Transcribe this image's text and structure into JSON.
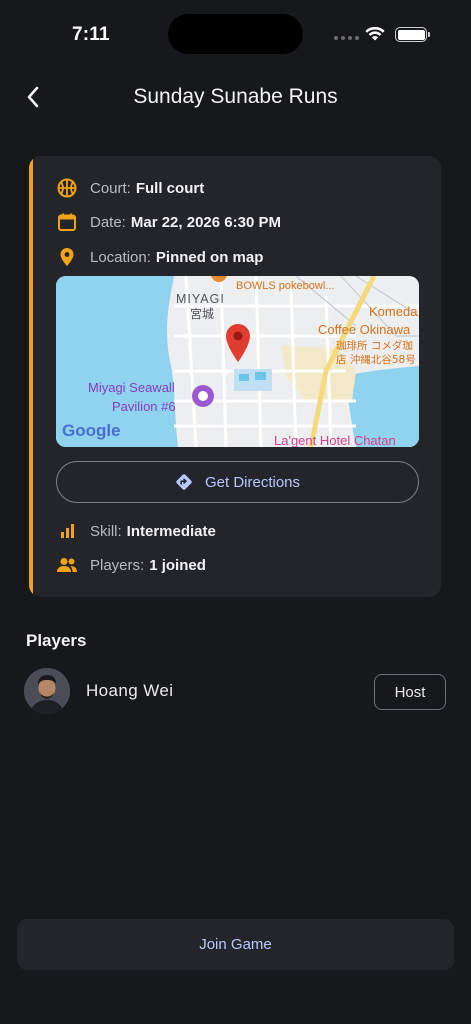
{
  "status_bar": {
    "time": "7:11"
  },
  "header": {
    "title": "Sunday Sunabe Runs"
  },
  "game": {
    "court_label": "Court:",
    "court_value": "Full court",
    "date_label": "Date:",
    "date_value": "Mar 22, 2026 6:30 PM",
    "location_label": "Location:",
    "location_value": "Pinned on map",
    "skill_label": "Skill:",
    "skill_value": "Intermediate",
    "players_label": "Players:",
    "players_value": "1 joined",
    "accent_color": "#f1a21a"
  },
  "map": {
    "labels": {
      "area_en": "MIYAGI",
      "area_jp": "宮城",
      "bowls": "BOWLS pokebowl...",
      "komeda_1": "Komeda",
      "komeda_2": "Coffee Okinawa",
      "komeda_3": "珈琲所 コメダ珈",
      "komeda_4": "店 沖縄北谷58号",
      "seawall_1": "Miyagi Seawall",
      "seawall_2": "Pavilion #6",
      "hotel": "La'gent Hotel Chatan",
      "google": "Google"
    }
  },
  "directions_button": "Get Directions",
  "players_section": {
    "title": "Players",
    "players": [
      {
        "name": "Hoang Wei",
        "badge": "Host"
      }
    ]
  },
  "join_button": "Join Game",
  "icons": {
    "back": "chevron-left-icon",
    "court": "basketball-icon",
    "date": "calendar-icon",
    "location": "location-pin-icon",
    "directions": "directions-icon",
    "skill": "signal-bars-icon",
    "players": "people-icon"
  }
}
